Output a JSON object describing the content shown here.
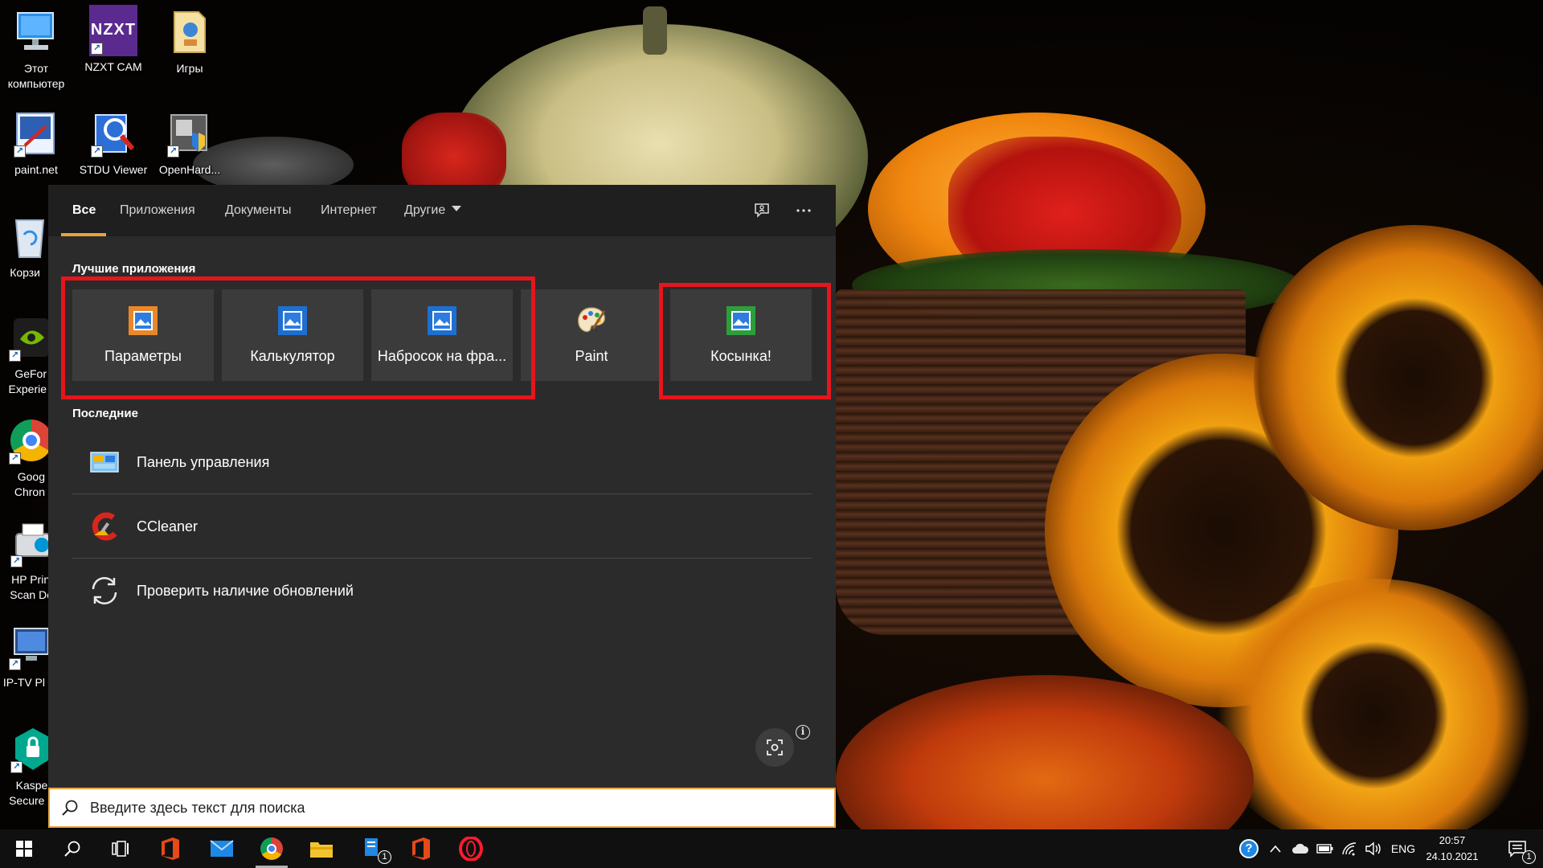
{
  "desktop": {
    "icons": [
      {
        "label": "Этот\nкомпьютер",
        "icon": "this-pc-icon"
      },
      {
        "label": "NZXT CAM",
        "icon": "nzxt-cam-icon",
        "badge_text": "NZXT"
      },
      {
        "label": "Игры",
        "icon": "folder-icon"
      },
      {
        "label": "paint.net",
        "icon": "paintnet-icon"
      },
      {
        "label": "STDU Viewer",
        "icon": "stdu-viewer-icon"
      },
      {
        "label": "OpenHard...",
        "icon": "openhardware-icon"
      },
      {
        "label": "Корзи",
        "icon": "recycle-bin-icon"
      },
      {
        "label": "GeFor\nExperie",
        "icon": "geforce-experience-icon"
      },
      {
        "label": "Goog\nChron",
        "icon": "google-chrome-icon"
      },
      {
        "label": "HP Print\nScan Do",
        "icon": "hp-print-scan-icon"
      },
      {
        "label": "IP-TV Pl",
        "icon": "iptv-player-icon"
      },
      {
        "label": "Kasper\nSecure (",
        "icon": "kaspersky-icon"
      }
    ]
  },
  "search": {
    "tabs": [
      {
        "label": "Все",
        "active": true
      },
      {
        "label": "Приложения"
      },
      {
        "label": "Документы"
      },
      {
        "label": "Интернет"
      },
      {
        "label": "Другие",
        "dropdown": true
      }
    ],
    "feedback_icon": "feedback-icon",
    "more_icon": "more-options-icon",
    "best_apps_title": "Лучшие приложения",
    "best_apps": [
      {
        "label": "Параметры",
        "icon": "app-image-icon",
        "color": "#e8882a"
      },
      {
        "label": "Калькулятор",
        "icon": "app-image-icon",
        "color": "#1f6fd1"
      },
      {
        "label": "Набросок на фра...",
        "icon": "app-image-icon",
        "color": "#1f6fd1"
      },
      {
        "label": "Paint",
        "icon": "paint-palette-icon"
      },
      {
        "label": "Косынка!",
        "icon": "app-image-icon",
        "color": "#2e9d3c"
      }
    ],
    "recent_title": "Последние",
    "recent": [
      {
        "label": "Панель управления",
        "icon": "control-panel-icon"
      },
      {
        "label": "CCleaner",
        "icon": "ccleaner-icon"
      },
      {
        "label": "Проверить наличие обновлений",
        "icon": "sync-icon"
      }
    ],
    "lens_icon": "screenshot-search-icon",
    "info_glyph": "i",
    "input_placeholder": "Введите здесь текст для поиска",
    "input_value": ""
  },
  "taskbar": {
    "apps": [
      {
        "name": "start",
        "icon": "windows-start-icon"
      },
      {
        "name": "search",
        "icon": "search-icon"
      },
      {
        "name": "task-view",
        "icon": "task-view-icon"
      },
      {
        "name": "office",
        "icon": "office-icon"
      },
      {
        "name": "mail",
        "icon": "mail-icon"
      },
      {
        "name": "chrome",
        "icon": "chrome-icon"
      },
      {
        "name": "explorer",
        "icon": "file-explorer-icon"
      },
      {
        "name": "notes",
        "icon": "notes-icon",
        "badge": "1"
      },
      {
        "name": "office2",
        "icon": "office-icon"
      },
      {
        "name": "opera",
        "icon": "opera-icon"
      }
    ],
    "tray": {
      "help_glyph": "?",
      "language": "ENG",
      "time": "20:57",
      "date": "24.10.2021",
      "notification_count": "1"
    }
  },
  "colors": {
    "accent": "#e8a33d",
    "highlight_red": "#e6151c",
    "panel_bg": "#2b2b2b",
    "tile_bg": "#3b3b3b",
    "taskbar_bg": "#101010"
  }
}
